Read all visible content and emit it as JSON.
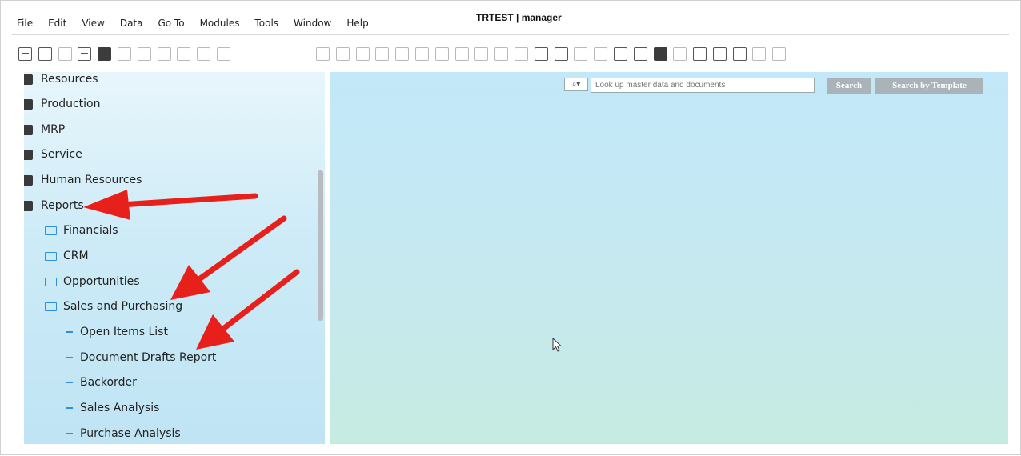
{
  "window": {
    "title": "TRTEST | manager"
  },
  "menu": [
    "File",
    "Edit",
    "View",
    "Data",
    "Go To",
    "Modules",
    "Tools",
    "Window",
    "Help"
  ],
  "search": {
    "placeholder": "Look up master data and documents",
    "search_label": "Search",
    "template_label": "Search by Template"
  },
  "sidebar": {
    "modules": [
      {
        "label": "Resources",
        "icon": "factory-icon"
      },
      {
        "label": "Production",
        "icon": "production-icon"
      },
      {
        "label": "MRP",
        "icon": "puzzle-icon"
      },
      {
        "label": "Service",
        "icon": "service-icon"
      },
      {
        "label": "Human Resources",
        "icon": "people-search-icon"
      },
      {
        "label": "Reports",
        "icon": "report-icon"
      }
    ],
    "report_folders": [
      "Financials",
      "CRM",
      "Opportunities",
      "Sales and Purchasing"
    ],
    "sales_reports": [
      "Open Items List",
      "Document Drafts Report",
      "Backorder",
      "Sales Analysis",
      "Purchase Analysis"
    ]
  },
  "colors": {
    "annotation_arrow": "#e8201c",
    "folder": "#2f8fe0"
  }
}
